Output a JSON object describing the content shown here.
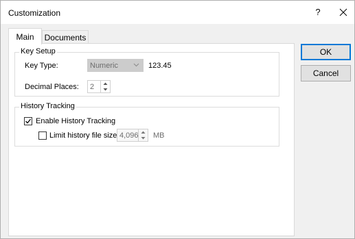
{
  "window": {
    "title": "Customization",
    "help_label": "?",
    "close_label": "×"
  },
  "tabs": [
    {
      "label": "Main",
      "selected": true
    },
    {
      "label": "Documents",
      "selected": false
    }
  ],
  "key_setup": {
    "legend": "Key Setup",
    "key_type_label": "Key Type:",
    "key_type_value": "Numeric",
    "key_type_preview": "123.45",
    "decimal_places_label": "Decimal Places:",
    "decimal_places_value": "2"
  },
  "history": {
    "legend": "History Tracking",
    "enable_label": "Enable History Tracking",
    "enable_checked": true,
    "limit_label": "Limit history file size:",
    "limit_checked": false,
    "limit_value": "4,096",
    "limit_unit": "MB"
  },
  "buttons": {
    "ok": "OK",
    "cancel": "Cancel"
  },
  "colors": {
    "ok_border": "#0078d7",
    "disabled_text": "#6d6d6d"
  }
}
